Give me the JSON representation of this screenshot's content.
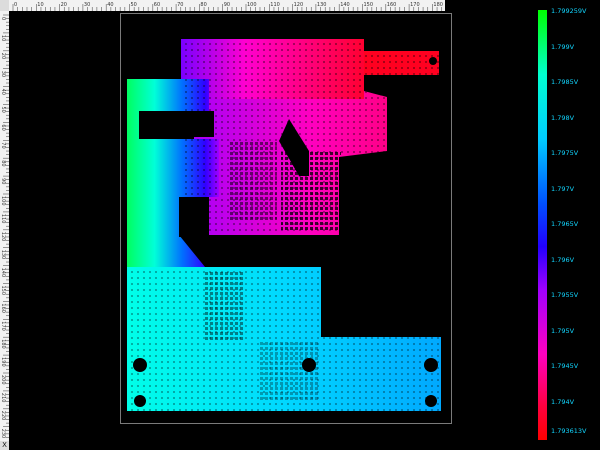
{
  "ruler": {
    "top_labels": [
      "0",
      "10",
      "20",
      "30",
      "40",
      "50",
      "60",
      "70",
      "80",
      "90",
      "100",
      "110",
      "120",
      "130",
      "140",
      "150",
      "160",
      "170",
      "180"
    ],
    "left_labels": [
      "0",
      "10",
      "20",
      "30",
      "40",
      "50",
      "60",
      "70",
      "80",
      "90",
      "100",
      "110",
      "120",
      "130",
      "140",
      "150",
      "160",
      "170",
      "180",
      "190",
      "200",
      "210",
      "220",
      "230"
    ]
  },
  "corner_bottom": "X",
  "legend": {
    "unit_note": "V",
    "labels": [
      "1.799259V",
      "1.799V",
      "1.7985V",
      "1.798V",
      "1.7975V",
      "1.797V",
      "1.7965V",
      "1.796V",
      "1.7955V",
      "1.795V",
      "1.7945V",
      "1.794V",
      "1.793613V"
    ],
    "gradient_colors": [
      "#00ff00",
      "#00ffd0",
      "#00ccff",
      "#0050ff",
      "#2200ff",
      "#a000ff",
      "#ff00c0",
      "#ff0040",
      "#ff0000"
    ]
  }
}
